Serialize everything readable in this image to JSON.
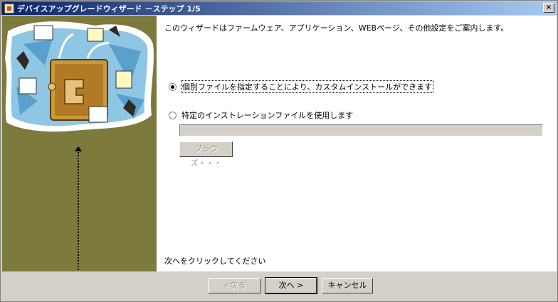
{
  "window": {
    "title": "デバイスアップグレードウィザード －ステップ 1/5",
    "close_label": "×"
  },
  "content": {
    "intro": "このウィザードはファームウェア、アプリケーション、WEBページ、その他設定をご案内します。",
    "options": [
      {
        "label": "個別ファイルを指定することにより、カスタムインストールができます",
        "selected": true
      },
      {
        "label": "特定のインストレーションファイルを使用します",
        "selected": false
      }
    ],
    "file_input": {
      "value": "",
      "placeholder": ""
    },
    "browse_label": "ブラウズ・・・",
    "hint": "次へをクリックしてください"
  },
  "footer": {
    "back_label": "<戻る",
    "next_label": "次へ >",
    "cancel_label": "キャンセル"
  },
  "colors": {
    "title_start": "#0a246a",
    "title_end": "#a6caf0",
    "sidebar": "#7c7a3c",
    "face": "#d4d0c8"
  }
}
